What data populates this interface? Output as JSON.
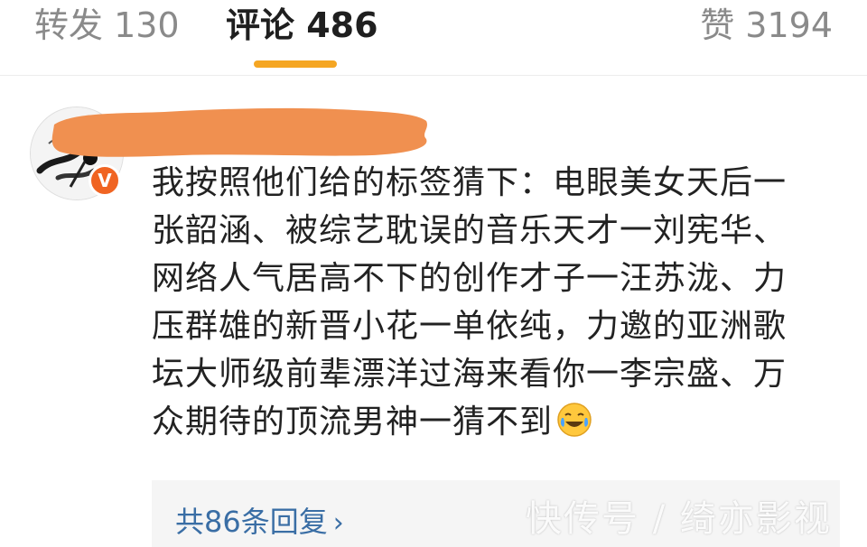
{
  "tabs": {
    "repost": "转发 130",
    "comment": "评论 486",
    "like": "赞 3194",
    "active_color": "#f5a623"
  },
  "comment": {
    "verified_badge": "V",
    "badge_color": "#f06422",
    "redaction_color": "#f09050",
    "lines": [
      "我按照他们给的标签猜下：电眼美女天后一",
      "张韶涵、被综艺耽误的音乐天才一刘宪华、",
      "网络人气居高不下的创作才子一汪苏泷、力",
      "压群雄的新晋小花一单依纯，力邀的亚洲歌",
      "坛大师级前辈漂洋过海来看你一李宗盛、万",
      "众期待的顶流男神一猜不到"
    ],
    "emoji": "laughing-crying-emoji"
  },
  "replies": {
    "label": "共86条回复",
    "chevron": "›",
    "link_color": "#3a6ea5"
  },
  "watermark": "快传号 / 绮亦影视"
}
